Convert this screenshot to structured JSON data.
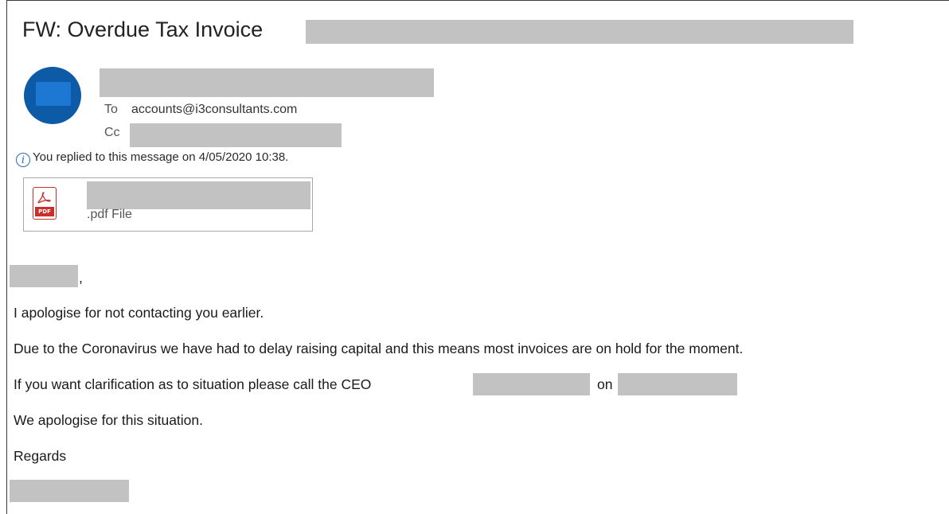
{
  "message": {
    "subject": "FW: Overdue Tax Invoice",
    "to_label": "To",
    "to_value": "accounts@i3consultants.com",
    "cc_label": "Cc",
    "info_text": "You replied to this message on 4/05/2020 10:38.",
    "attachment": {
      "type_label": ".pdf File",
      "icon_text": "PDF"
    }
  },
  "body": {
    "salutation_comma": ",",
    "line1": "I apologise for not contacting you earlier.",
    "line2": "Due to the Coronavirus we have had to delay raising capital and this means most invoices are on hold for the moment.",
    "line3_prefix": "If you want clarification as to situation please call the CEO",
    "line3_mid": "on",
    "line4": "We apologise for this situation.",
    "line5": "Regards"
  },
  "colors": {
    "avatar": "#0d5aa6",
    "info_icon": "#2b6cb0",
    "pdf_red": "#c9302c",
    "redaction": "#c2c2c2"
  },
  "icons": {
    "info": "info-icon",
    "attachment": "pdf-file-icon",
    "avatar": "sender-avatar"
  }
}
